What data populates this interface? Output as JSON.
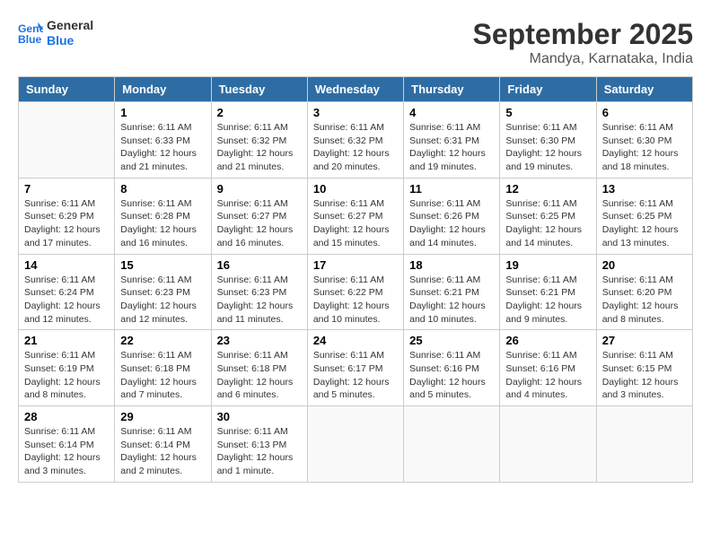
{
  "logo": {
    "line1": "General",
    "line2": "Blue"
  },
  "title": "September 2025",
  "subtitle": "Mandya, Karnataka, India",
  "days_of_week": [
    "Sunday",
    "Monday",
    "Tuesday",
    "Wednesday",
    "Thursday",
    "Friday",
    "Saturday"
  ],
  "weeks": [
    [
      {
        "num": "",
        "info": ""
      },
      {
        "num": "1",
        "info": "Sunrise: 6:11 AM\nSunset: 6:33 PM\nDaylight: 12 hours\nand 21 minutes."
      },
      {
        "num": "2",
        "info": "Sunrise: 6:11 AM\nSunset: 6:32 PM\nDaylight: 12 hours\nand 21 minutes."
      },
      {
        "num": "3",
        "info": "Sunrise: 6:11 AM\nSunset: 6:32 PM\nDaylight: 12 hours\nand 20 minutes."
      },
      {
        "num": "4",
        "info": "Sunrise: 6:11 AM\nSunset: 6:31 PM\nDaylight: 12 hours\nand 19 minutes."
      },
      {
        "num": "5",
        "info": "Sunrise: 6:11 AM\nSunset: 6:30 PM\nDaylight: 12 hours\nand 19 minutes."
      },
      {
        "num": "6",
        "info": "Sunrise: 6:11 AM\nSunset: 6:30 PM\nDaylight: 12 hours\nand 18 minutes."
      }
    ],
    [
      {
        "num": "7",
        "info": "Sunrise: 6:11 AM\nSunset: 6:29 PM\nDaylight: 12 hours\nand 17 minutes."
      },
      {
        "num": "8",
        "info": "Sunrise: 6:11 AM\nSunset: 6:28 PM\nDaylight: 12 hours\nand 16 minutes."
      },
      {
        "num": "9",
        "info": "Sunrise: 6:11 AM\nSunset: 6:27 PM\nDaylight: 12 hours\nand 16 minutes."
      },
      {
        "num": "10",
        "info": "Sunrise: 6:11 AM\nSunset: 6:27 PM\nDaylight: 12 hours\nand 15 minutes."
      },
      {
        "num": "11",
        "info": "Sunrise: 6:11 AM\nSunset: 6:26 PM\nDaylight: 12 hours\nand 14 minutes."
      },
      {
        "num": "12",
        "info": "Sunrise: 6:11 AM\nSunset: 6:25 PM\nDaylight: 12 hours\nand 14 minutes."
      },
      {
        "num": "13",
        "info": "Sunrise: 6:11 AM\nSunset: 6:25 PM\nDaylight: 12 hours\nand 13 minutes."
      }
    ],
    [
      {
        "num": "14",
        "info": "Sunrise: 6:11 AM\nSunset: 6:24 PM\nDaylight: 12 hours\nand 12 minutes."
      },
      {
        "num": "15",
        "info": "Sunrise: 6:11 AM\nSunset: 6:23 PM\nDaylight: 12 hours\nand 12 minutes."
      },
      {
        "num": "16",
        "info": "Sunrise: 6:11 AM\nSunset: 6:23 PM\nDaylight: 12 hours\nand 11 minutes."
      },
      {
        "num": "17",
        "info": "Sunrise: 6:11 AM\nSunset: 6:22 PM\nDaylight: 12 hours\nand 10 minutes."
      },
      {
        "num": "18",
        "info": "Sunrise: 6:11 AM\nSunset: 6:21 PM\nDaylight: 12 hours\nand 10 minutes."
      },
      {
        "num": "19",
        "info": "Sunrise: 6:11 AM\nSunset: 6:21 PM\nDaylight: 12 hours\nand 9 minutes."
      },
      {
        "num": "20",
        "info": "Sunrise: 6:11 AM\nSunset: 6:20 PM\nDaylight: 12 hours\nand 8 minutes."
      }
    ],
    [
      {
        "num": "21",
        "info": "Sunrise: 6:11 AM\nSunset: 6:19 PM\nDaylight: 12 hours\nand 8 minutes."
      },
      {
        "num": "22",
        "info": "Sunrise: 6:11 AM\nSunset: 6:18 PM\nDaylight: 12 hours\nand 7 minutes."
      },
      {
        "num": "23",
        "info": "Sunrise: 6:11 AM\nSunset: 6:18 PM\nDaylight: 12 hours\nand 6 minutes."
      },
      {
        "num": "24",
        "info": "Sunrise: 6:11 AM\nSunset: 6:17 PM\nDaylight: 12 hours\nand 5 minutes."
      },
      {
        "num": "25",
        "info": "Sunrise: 6:11 AM\nSunset: 6:16 PM\nDaylight: 12 hours\nand 5 minutes."
      },
      {
        "num": "26",
        "info": "Sunrise: 6:11 AM\nSunset: 6:16 PM\nDaylight: 12 hours\nand 4 minutes."
      },
      {
        "num": "27",
        "info": "Sunrise: 6:11 AM\nSunset: 6:15 PM\nDaylight: 12 hours\nand 3 minutes."
      }
    ],
    [
      {
        "num": "28",
        "info": "Sunrise: 6:11 AM\nSunset: 6:14 PM\nDaylight: 12 hours\nand 3 minutes."
      },
      {
        "num": "29",
        "info": "Sunrise: 6:11 AM\nSunset: 6:14 PM\nDaylight: 12 hours\nand 2 minutes."
      },
      {
        "num": "30",
        "info": "Sunrise: 6:11 AM\nSunset: 6:13 PM\nDaylight: 12 hours\nand 1 minute."
      },
      {
        "num": "",
        "info": ""
      },
      {
        "num": "",
        "info": ""
      },
      {
        "num": "",
        "info": ""
      },
      {
        "num": "",
        "info": ""
      }
    ]
  ]
}
